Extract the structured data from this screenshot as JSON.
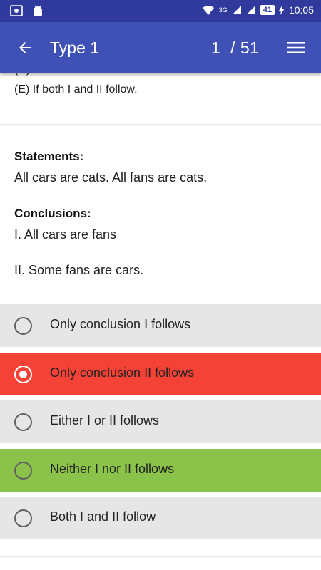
{
  "status_bar": {
    "network": "3G",
    "battery": "41",
    "time": "10:05"
  },
  "app_bar": {
    "title": "Type 1",
    "counter": "1  / 51"
  },
  "previous_question": {
    "partial_line": "(D) If neither I nor II follows and",
    "option_e": "(E) If both I and II follow."
  },
  "question": {
    "statements_label": "Statements:",
    "statements_text": "All cars are cats. All fans are cats.",
    "conclusions_label": "Conclusions:",
    "conclusion_1": "I. All cars are fans",
    "conclusion_2": "II. Some fans are cars."
  },
  "options": [
    {
      "label": "Only conclusion I follows",
      "state": "default",
      "selected": false
    },
    {
      "label": "Only conclusion II follows",
      "state": "wrong",
      "selected": true
    },
    {
      "label": "Either I or II follows",
      "state": "default",
      "selected": false
    },
    {
      "label": "Neither I nor II follows",
      "state": "correct",
      "selected": false
    },
    {
      "label": "Both I and II follow",
      "state": "default",
      "selected": false
    }
  ],
  "colors": {
    "status_bar": "#2f3a9c",
    "app_bar": "#3f51b5",
    "option_default": "#e6e6e6",
    "option_wrong": "#f44336",
    "option_correct": "#8bc34a"
  }
}
